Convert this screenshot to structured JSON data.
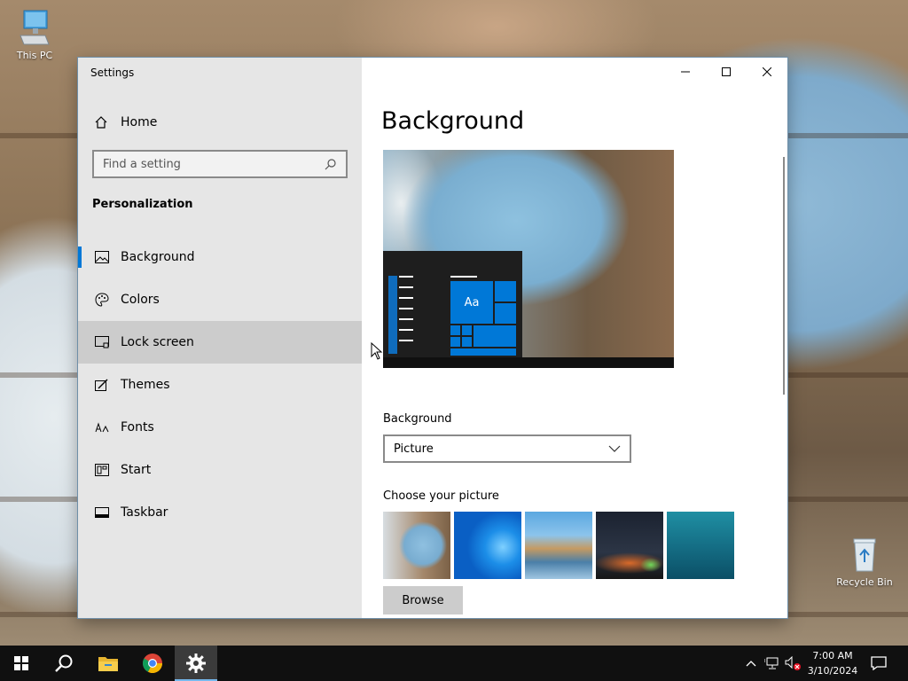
{
  "desktop": {
    "icons": [
      {
        "label": "This PC"
      },
      {
        "label": "Recycle Bin"
      }
    ]
  },
  "window": {
    "title": "Settings",
    "controls": [
      "minimize",
      "maximize",
      "close"
    ]
  },
  "nav": {
    "home_label": "Home",
    "search_placeholder": "Find a setting",
    "section_title": "Personalization",
    "items": [
      {
        "label": "Background",
        "icon": "picture-icon",
        "active": true
      },
      {
        "label": "Colors",
        "icon": "palette-icon"
      },
      {
        "label": "Lock screen",
        "icon": "lock-screen-icon",
        "hovered": true
      },
      {
        "label": "Themes",
        "icon": "themes-icon"
      },
      {
        "label": "Fonts",
        "icon": "fonts-icon"
      },
      {
        "label": "Start",
        "icon": "start-icon"
      },
      {
        "label": "Taskbar",
        "icon": "taskbar-icon"
      }
    ]
  },
  "content": {
    "title": "Background",
    "preview_tile_text": "Aa",
    "background_label": "Background",
    "background_value": "Picture",
    "choose_label": "Choose your picture",
    "browse_label": "Browse"
  },
  "taskbar": {
    "pinned": [
      "start-icon",
      "search-icon",
      "file-explorer-icon",
      "chrome-icon",
      "settings-icon"
    ],
    "clock_time": "7:00 AM",
    "clock_date": "3/10/2024"
  },
  "colors": {
    "accent": "#0078d7",
    "nav_bg": "#e6e6e6",
    "hover_bg": "#cccccc",
    "taskbar_bg": "#101010"
  }
}
